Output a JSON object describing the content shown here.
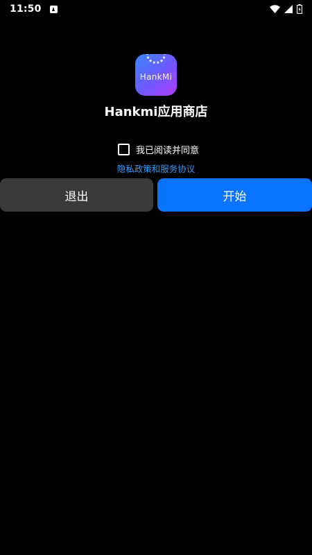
{
  "status_bar": {
    "time": "11:50",
    "icons": [
      "notification-a-icon",
      "wifi-icon",
      "signal-icon",
      "battery-icon"
    ]
  },
  "app": {
    "icon_text": "HankMi",
    "title": "Hankmi应用商店"
  },
  "agreement": {
    "checked": false,
    "label": "我已阅读并同意",
    "policy_link": "隐私政策和服务协议"
  },
  "buttons": {
    "exit_label": "退出",
    "start_label": "开始"
  },
  "colors": {
    "background": "#000000",
    "link": "#2f9bff",
    "start_button": "#0a73ff",
    "exit_button": "#3a3a3a"
  }
}
